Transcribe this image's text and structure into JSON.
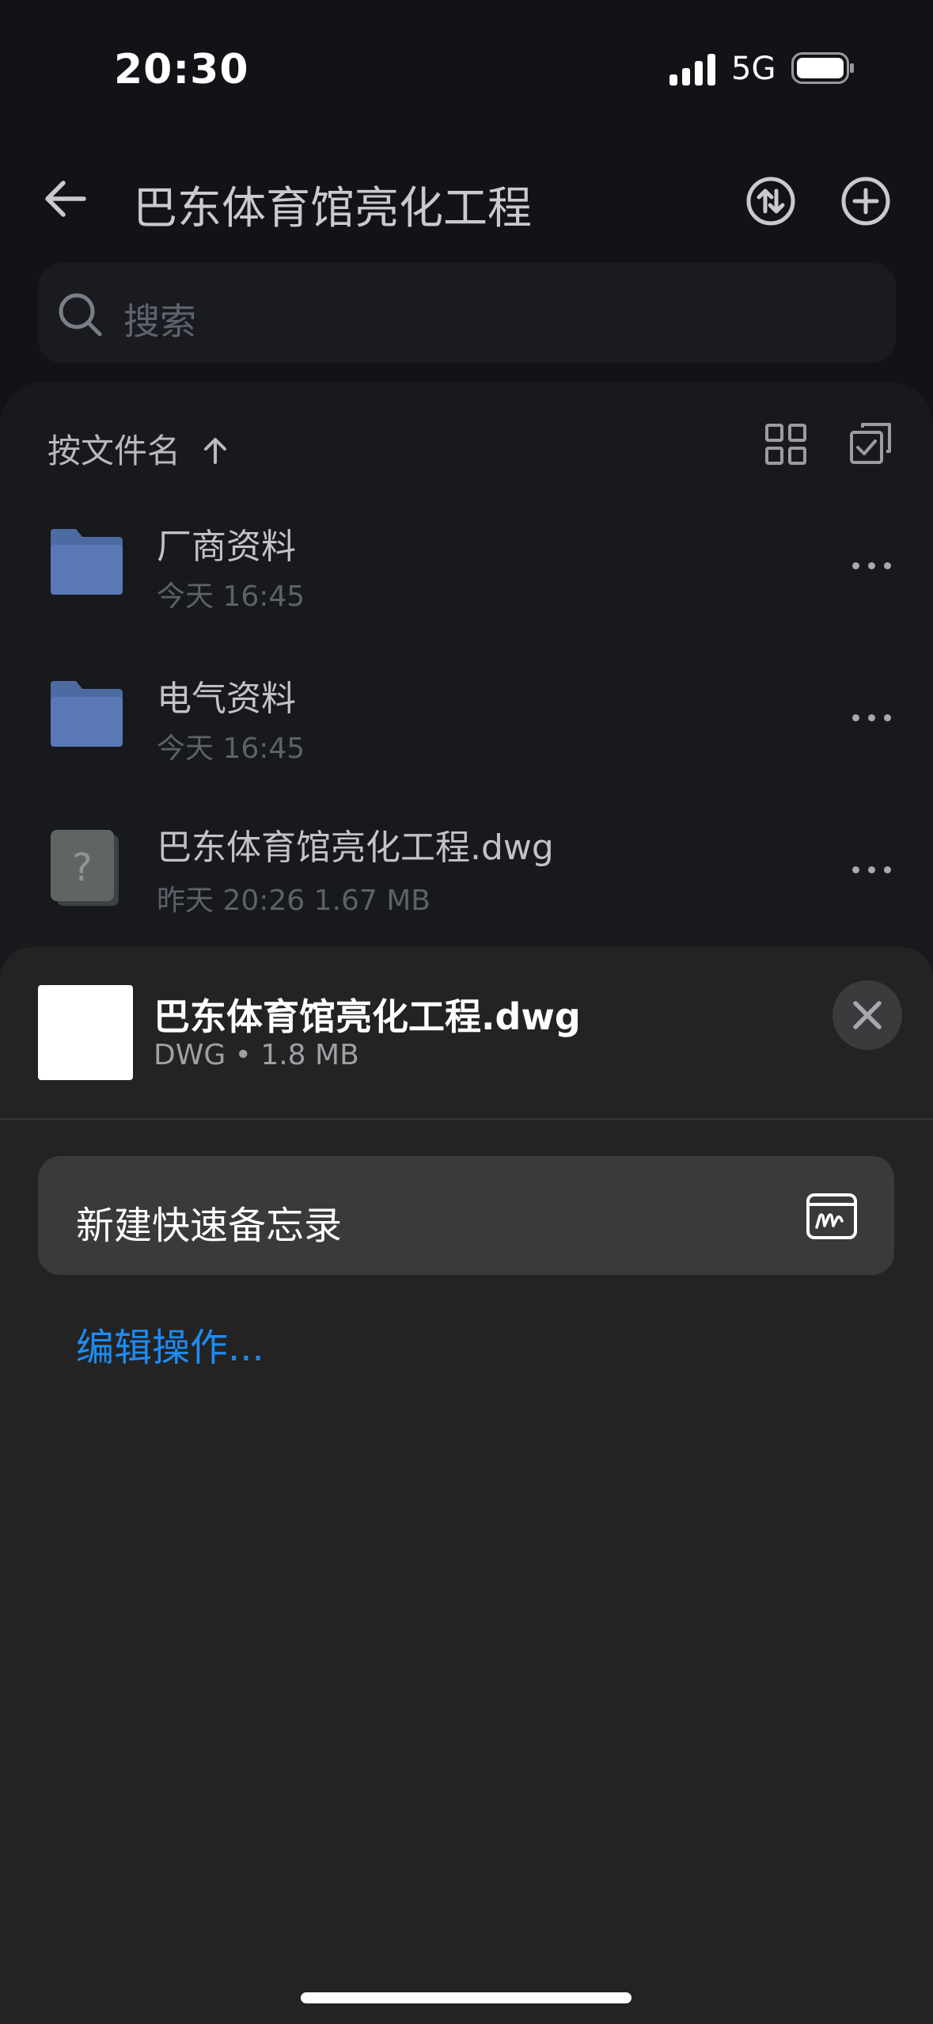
{
  "status_bar": {
    "time": "20:30",
    "network": "5G"
  },
  "header": {
    "title": "巴东体育馆亮化工程"
  },
  "search": {
    "placeholder": "搜索"
  },
  "sort": {
    "label": "按文件名"
  },
  "files": [
    {
      "name": "厂商资料",
      "meta": "今天 16:45",
      "type": "folder"
    },
    {
      "name": "电气资料",
      "meta": "今天 16:45",
      "type": "folder"
    },
    {
      "name": "巴东体育馆亮化工程.dwg",
      "meta": "昨天 20:26  1.67 MB",
      "type": "unknown-file"
    }
  ],
  "sheet": {
    "file_name": "巴东体育馆亮化工程.dwg",
    "file_meta": "DWG • 1.8 MB",
    "action_label": "新建快速备忘录",
    "edit_label": "编辑操作..."
  },
  "colors": {
    "accent_link": "#1f8bf0",
    "folder": "#5b79b6"
  }
}
